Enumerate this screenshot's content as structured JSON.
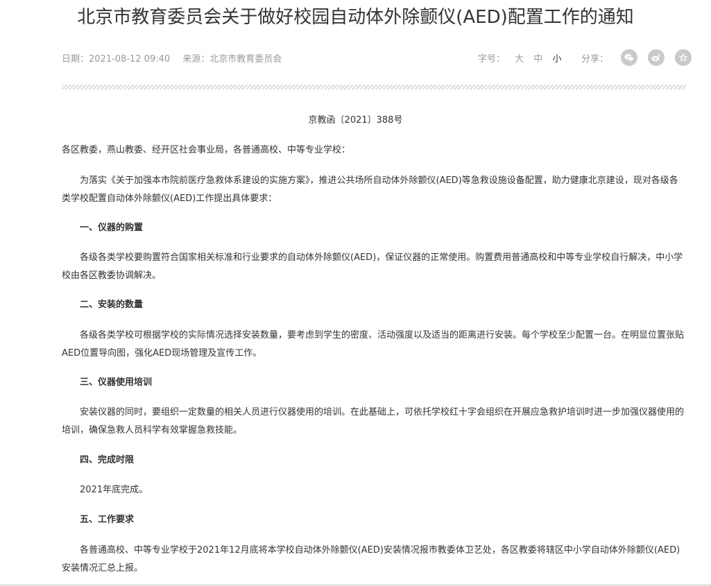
{
  "article": {
    "title": "北京市教育委员会关于做好校园自动体外除颤仪(AED)配置工作的通知",
    "date": "日期：2021-08-12 09:40",
    "source": "来源：北京市教育委员会",
    "font_size_label": "字号：",
    "font_size_options": [
      "大",
      "中",
      "小"
    ],
    "share_label": "分享：",
    "share_icons": [
      "wechat-icon",
      "weibo-icon",
      "favorite-icon"
    ],
    "doc_number": "京教函〔2021〕388号",
    "salutation": "各区教委，燕山教委、经开区社会事业局，各普通高校、中等专业学校：",
    "intro": "为落实《关于加强本市院前医疗急救体系建设的实施方案》，推进公共场所自动体外除颤仪(AED)等急救设施设备配置，助力健康北京建设，现对各级各类学校配置自动体外除颤仪(AED)工作提出具体要求：",
    "sections": [
      {
        "heading": "一、仪器的购置",
        "body": "各级各类学校要购置符合国家相关标准和行业要求的自动体外除颤仪(AED)，保证仪器的正常使用。购置费用普通高校和中等专业学校自行解决，中小学校由各区教委协调解决。"
      },
      {
        "heading": "二、安装的数量",
        "body": "各级各类学校可根据学校的实际情况选择安装数量，要考虑到学生的密度、活动强度以及适当的距离进行安装。每个学校至少配置一台。在明显位置张贴AED位置导向图，强化AED现场管理及宣传工作。"
      },
      {
        "heading": "三、仪器使用培训",
        "body": "安装仪器的同时，要组织一定数量的相关人员进行仪器使用的培训。在此基础上，可依托学校红十字会组织在开展应急救护培训时进一步加强仪器使用的培训，确保急救人员科学有效掌握急救技能。"
      },
      {
        "heading": "四、完成时限",
        "body": "2021年底完成。"
      },
      {
        "heading": "五、工作要求",
        "body": "各普通高校、中等专业学校于2021年12月底将本学校自动体外除颤仪(AED)安装情况报市教委体卫艺处，各区教委将辖区中小学自动体外除颤仪(AED)安装情况汇总上报。"
      }
    ]
  },
  "colors": {
    "text": "#333333",
    "meta": "#9a9a9a",
    "icon_bg": "#c9c9c9",
    "divider": "#dcdcdc"
  }
}
